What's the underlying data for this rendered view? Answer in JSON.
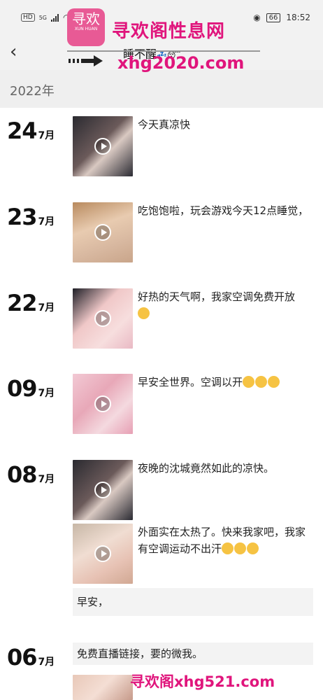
{
  "status": {
    "hd": "HD",
    "net": "5G",
    "time": "18:52",
    "battery": "66"
  },
  "nav": {
    "title": "睡不醒",
    "title_emoji": "💤😴"
  },
  "watermark": {
    "logo_text": "寻欢",
    "logo_sub": "XUN HUAN",
    "site_name": "寻欢阁性息网",
    "site_url": "xhg2020.com",
    "bottom_mark": "寻欢阁xhg521.com"
  },
  "year": "2022年",
  "posts": [
    {
      "day": "24",
      "month": "7月",
      "caption": "今天真凉快",
      "has_video": true
    },
    {
      "day": "23",
      "month": "7月",
      "caption": "吃饱饱啦，玩会游戏今天12点睡觉，",
      "has_video": true
    },
    {
      "day": "22",
      "month": "7月",
      "caption": "好热的天气啊，我家空调免费开放",
      "emoji_count": 1,
      "has_video": true
    },
    {
      "day": "09",
      "month": "7月",
      "caption": "早安全世界。空调以开",
      "emoji_count": 3,
      "has_video": true
    },
    {
      "day": "08",
      "month": "7月",
      "caption": "夜晚的沈城竟然如此的凉快。",
      "has_video": true
    },
    {
      "caption": "外面实在太热了。快来我家吧，我家有空调运动不出汗",
      "emoji_count": 3,
      "has_video": true
    },
    {
      "text_only": "早安，"
    },
    {
      "day": "06",
      "month": "7月",
      "text_only": "免费直播链接，要的微我。"
    }
  ],
  "colors": {
    "watermark": "#e0157c",
    "header_bg": "#f2f2f2",
    "text_post_bg": "#f3f3f3"
  }
}
